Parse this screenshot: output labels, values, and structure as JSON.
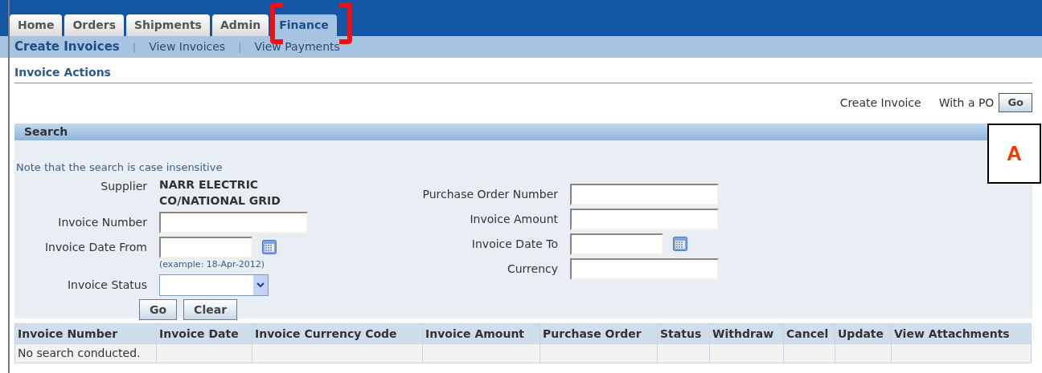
{
  "tabs": [
    {
      "label": "Home",
      "selected": false
    },
    {
      "label": "Orders",
      "selected": false
    },
    {
      "label": "Shipments",
      "selected": false
    },
    {
      "label": "Admin",
      "selected": false
    },
    {
      "label": "Finance",
      "selected": true
    }
  ],
  "subtabs": [
    {
      "label": "Create Invoices",
      "selected": true
    },
    {
      "label": "View Invoices",
      "selected": false
    },
    {
      "label": "View Payments",
      "selected": false
    }
  ],
  "subtab_separator": "|",
  "section_title": "Invoice Actions",
  "create_invoice": {
    "label": "Create Invoice",
    "option": "With a PO",
    "button": "Go"
  },
  "search": {
    "title": "Search",
    "note": "Note that the search is case insensitive",
    "left_fields": [
      {
        "kind": "text",
        "label": "Supplier",
        "value": "NARR ELECTRIC CO/NATIONAL GRID"
      },
      {
        "kind": "input",
        "label": "Invoice Number"
      },
      {
        "kind": "date",
        "label": "Invoice Date From",
        "hint": "(example: 18-Apr-2012)"
      },
      {
        "kind": "select",
        "label": "Invoice Status"
      }
    ],
    "right_fields": [
      {
        "kind": "input",
        "label": "Purchase Order Number"
      },
      {
        "kind": "input",
        "label": "Invoice Amount"
      },
      {
        "kind": "date",
        "label": "Invoice Date To"
      },
      {
        "kind": "input",
        "label": "Currency"
      }
    ],
    "buttons": [
      "Go",
      "Clear"
    ]
  },
  "table": {
    "columns": [
      "Invoice Number",
      "Invoice Date",
      "Invoice Currency Code",
      "Invoice Amount",
      "Purchase Order",
      "Status",
      "Withdraw",
      "Cancel",
      "Update",
      "View Attachments"
    ],
    "empty_message": "No search conducted."
  },
  "callout": {
    "label": "A"
  }
}
